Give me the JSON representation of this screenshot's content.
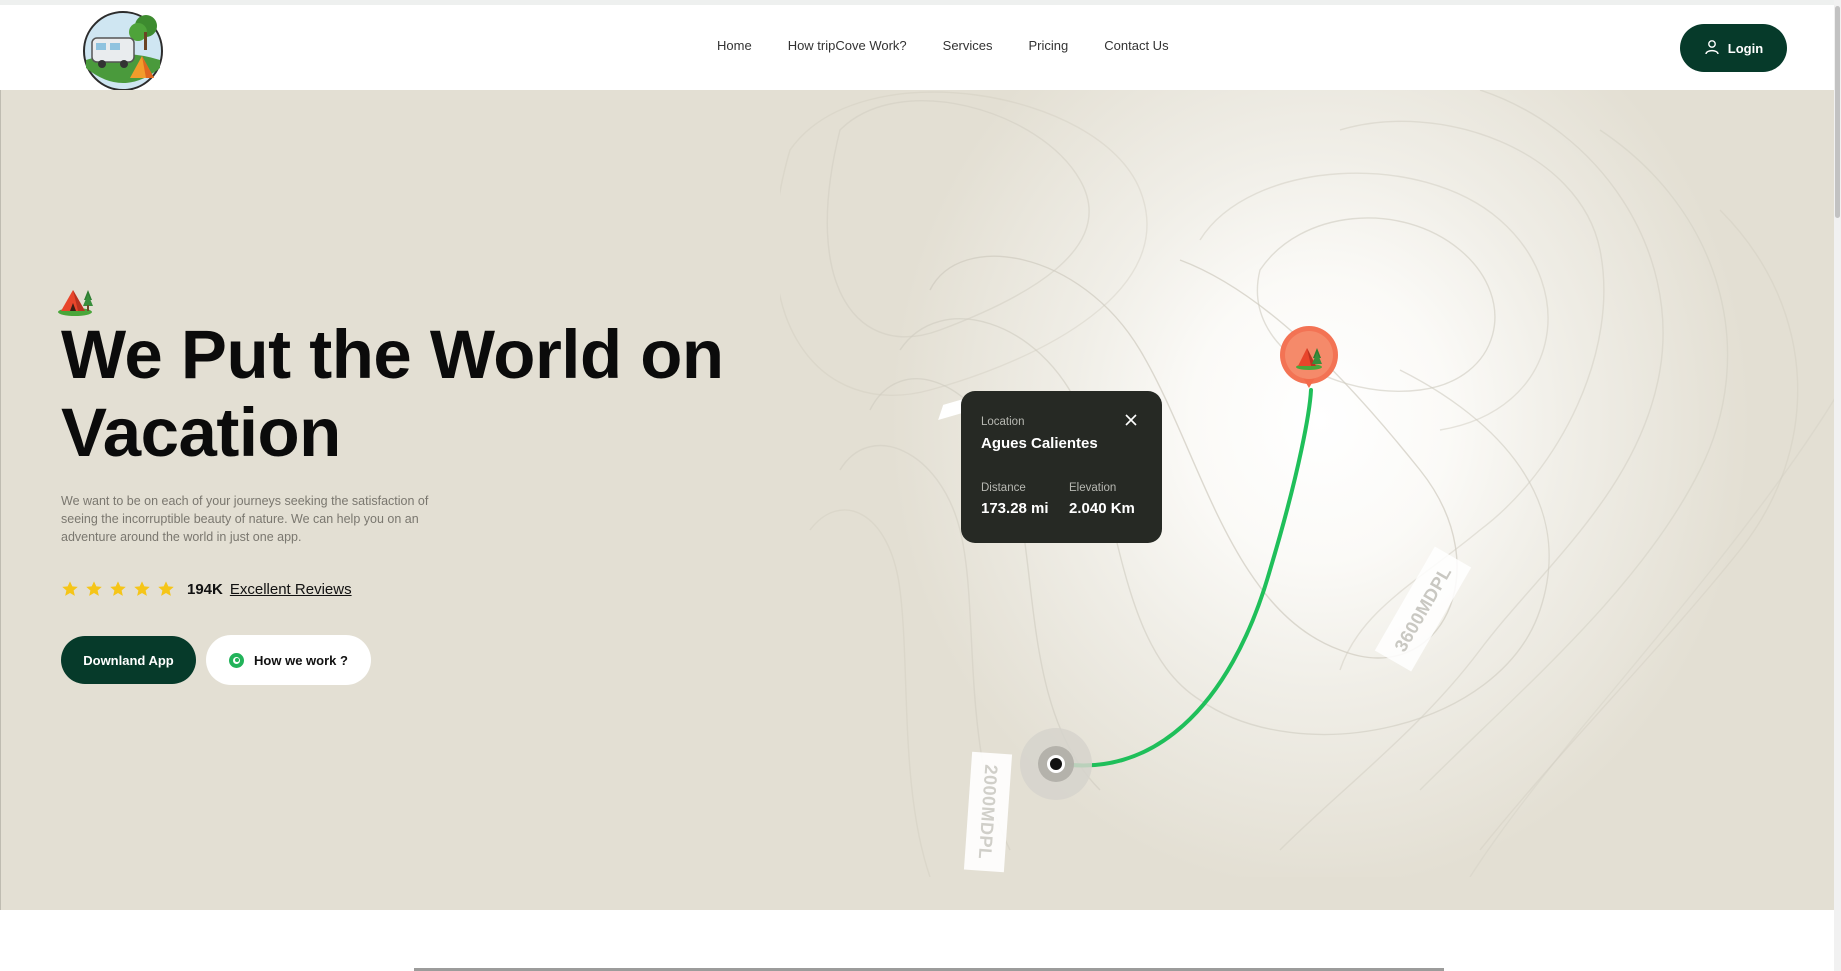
{
  "header": {
    "logo_icon": "camper-van-logo-icon",
    "nav": [
      {
        "label": "Home"
      },
      {
        "label": "How tripCove Work?"
      },
      {
        "label": "Services"
      },
      {
        "label": "Pricing"
      },
      {
        "label": "Contact Us"
      }
    ],
    "login_label": "Login",
    "login_icon": "user-icon"
  },
  "hero": {
    "title": "We Put the World on Vacation",
    "description": "We want to be on each of your journeys seeking the satisfaction of seeing the incorruptible beauty of nature. We can help you on an adventure around the world in just one app.",
    "rating": {
      "stars": 5,
      "count": "194K",
      "link_label": "Excellent Reviews",
      "star_color": "#f5c518"
    },
    "buttons": {
      "download_label": "Downland App",
      "how_label": "How we work ?"
    },
    "accent_dark": "#063a2a",
    "accent_green": "#22b35a"
  },
  "map": {
    "card": {
      "location_label": "Location",
      "location_value": "Agues Calientes",
      "distance_label": "Distance",
      "distance_value": "173.28 mi",
      "elevation_label": "Elevation",
      "elevation_value": "2.040 Km"
    },
    "contour_labels": [
      "3600MDPL",
      "2000MDPL"
    ],
    "pin_color": "#f26b4b",
    "route_color": "#1fbf5a"
  }
}
